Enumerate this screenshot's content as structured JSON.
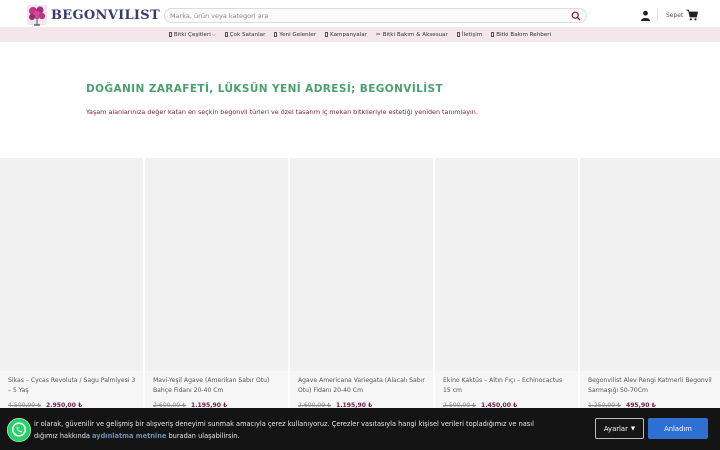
{
  "header": {
    "logo_text": "BEGONVILIST",
    "search_placeholder": "Marka, ürün veya kategori ara",
    "cart_label": "Sepet"
  },
  "nav": {
    "items": [
      {
        "label": "Bitki Çeşitleri",
        "has_dropdown": true
      },
      {
        "label": "Çok Satanlar"
      },
      {
        "label": "Yeni Gelenler"
      },
      {
        "label": "Kampanyalar"
      },
      {
        "label": "Bitki Bakım & Aksesuar"
      },
      {
        "label": "İletişim"
      },
      {
        "label": "Bitki Bakım Rehberi"
      }
    ]
  },
  "hero": {
    "title": "DOĞANIN ZARAFETİ, LÜKSÜN YENİ ADRESİ; BEGONVİLİST",
    "text": "Yaşam alanlarınıza değer katan en seçkin begonvil türleri ve özel tasarım iç mekan bitkileriyle estetiği yeniden tanımlayın."
  },
  "products": [
    {
      "name": "Sikas – Cycas Revoluta / Sagu Palmiyesi 3 – 5 Yaş",
      "old_price": "4.500,00 ₺",
      "price": "2.950,00 ₺"
    },
    {
      "name": "Mavi-Yeşil Agave (Amerikan Sabır Otu) Bahçe Fidanı 20-40 Cm",
      "old_price": "2.600,00 ₺",
      "price": "1.195,90 ₺"
    },
    {
      "name": "Agave Americana Variegata (Alacalı Sabır Otu) Fidanı 20-40 Cm",
      "old_price": "2.600,00 ₺",
      "price": "1.195,90 ₺"
    },
    {
      "name": "Ekino Kaktüs – Altın Fıçı – Echinocactus 15 cm",
      "old_price": "2.500,00 ₺",
      "price": "1.450,00 ₺"
    },
    {
      "name": "Begonvilist Alev Rengi Katmerli Begonvil Sarmaşığı 50-70Cm",
      "old_price": "1.250,00 ₺",
      "price": "495,90 ₺"
    }
  ],
  "cookie": {
    "text_1": "ir olarak, güvenilir ve gelişmiş bir alışveriş deneyimi sunmak amacıyla çerez kullanıyoruz.  Çerezler vasıtasıyla hangi kişisel verileri topladığımız ve nasıl",
    "text_2_pre": "dığımız hakkında ",
    "link": "aydınlatma metnine",
    "text_2_post": " buradan ulaşabilirsin.",
    "settings_label": "Ayarlar",
    "accept_label": "Anladım"
  },
  "colors": {
    "nav_bg": "#f5e6ec",
    "hero_title": "#4aa16f",
    "accent": "#7a1846",
    "accept_button": "#2f6fd3",
    "whatsapp": "#25d366"
  }
}
